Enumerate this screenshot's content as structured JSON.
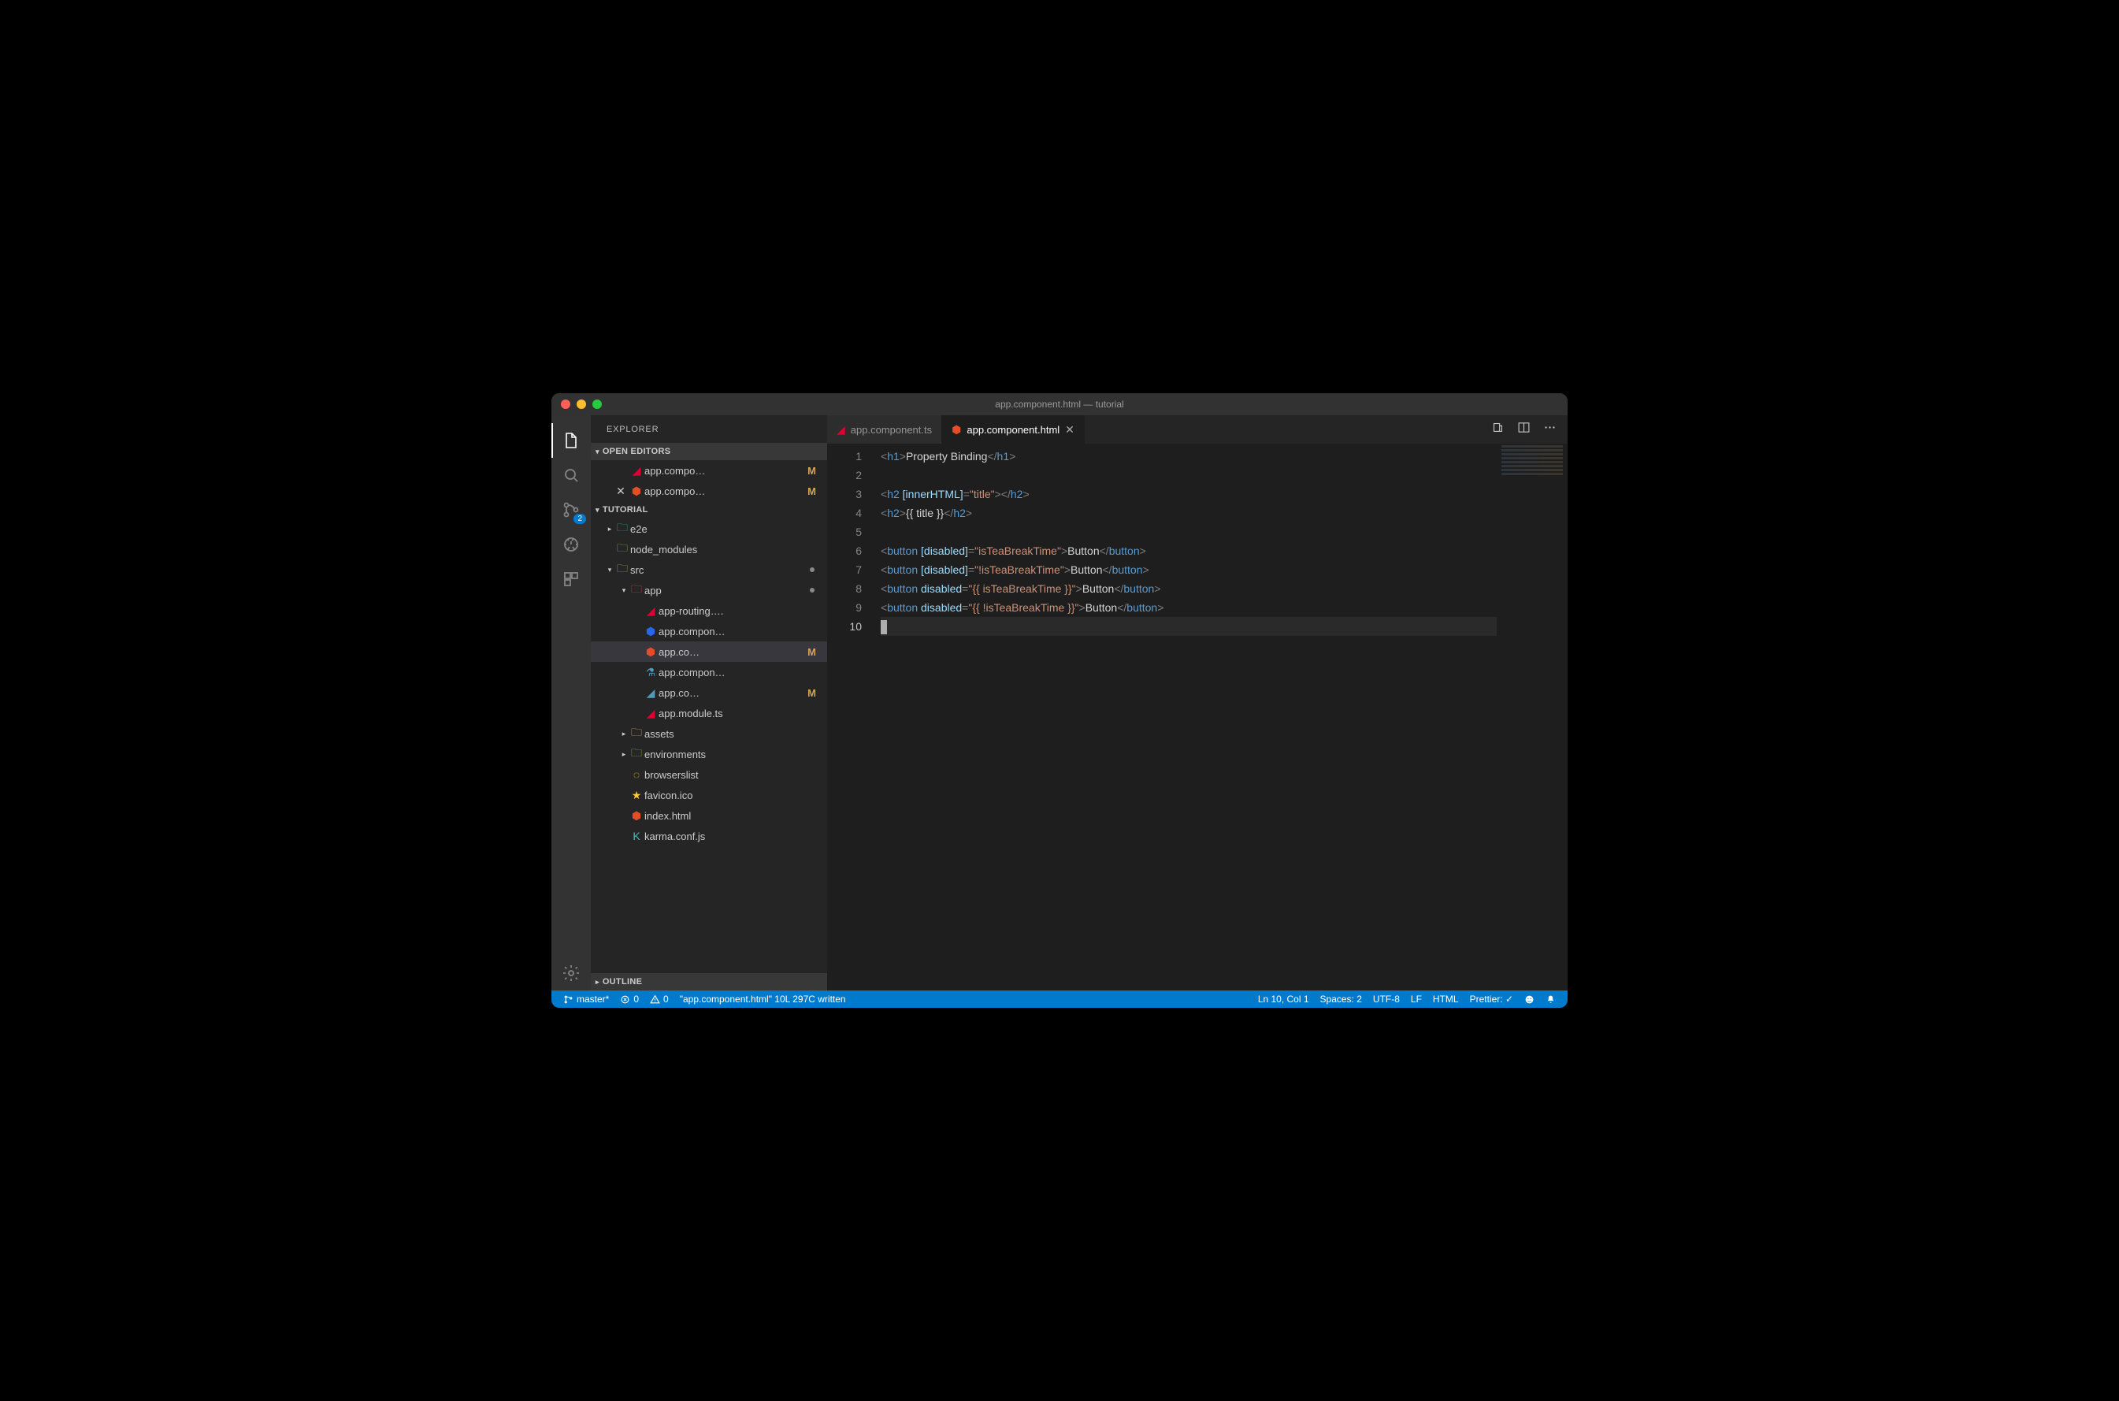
{
  "titlebar": {
    "title": "app.component.html — tutorial"
  },
  "sidebar": {
    "title": "EXPLORER",
    "open_editors_label": "OPEN EDITORS",
    "outline_label": "OUTLINE",
    "project_label": "TUTORIAL",
    "open_editors": [
      {
        "label": "app.compo…",
        "marker": "M",
        "icon": "angular"
      },
      {
        "label": "app.compo…",
        "marker": "M",
        "icon": "html",
        "close": true
      }
    ],
    "tree": [
      {
        "depth": 0,
        "tw": "▸",
        "icon": "folder-teal",
        "label": "e2e"
      },
      {
        "depth": 0,
        "tw": "",
        "icon": "folder-green",
        "label": "node_modules"
      },
      {
        "depth": 0,
        "tw": "▾",
        "icon": "folder-green",
        "label": "src",
        "mod": true
      },
      {
        "depth": 1,
        "tw": "▾",
        "icon": "folder-red",
        "label": "app",
        "mod": true
      },
      {
        "depth": 2,
        "tw": "",
        "icon": "angular",
        "label": "app-routing…."
      },
      {
        "depth": 2,
        "tw": "",
        "icon": "css",
        "label": "app.compon…"
      },
      {
        "depth": 2,
        "tw": "",
        "icon": "html",
        "label": "app.co…",
        "marker": "M",
        "sel": true
      },
      {
        "depth": 2,
        "tw": "",
        "icon": "flask",
        "label": "app.compon…"
      },
      {
        "depth": 2,
        "tw": "",
        "icon": "angular-sh",
        "label": "app.co…",
        "marker": "M"
      },
      {
        "depth": 2,
        "tw": "",
        "icon": "angular",
        "label": "app.module.ts"
      },
      {
        "depth": 1,
        "tw": "▸",
        "icon": "folder",
        "label": "assets"
      },
      {
        "depth": 1,
        "tw": "▸",
        "icon": "folder-green",
        "label": "environments"
      },
      {
        "depth": 1,
        "tw": "",
        "icon": "browserslist",
        "label": "browserslist"
      },
      {
        "depth": 1,
        "tw": "",
        "icon": "star",
        "label": "favicon.ico"
      },
      {
        "depth": 1,
        "tw": "",
        "icon": "html",
        "label": "index.html"
      },
      {
        "depth": 1,
        "tw": "",
        "icon": "karma",
        "label": "karma.conf.js"
      }
    ]
  },
  "activity_badge": "2",
  "tabs": [
    {
      "label": "app.component.ts",
      "icon": "angular",
      "active": false
    },
    {
      "label": "app.component.html",
      "icon": "html",
      "active": true,
      "close": true
    }
  ],
  "editor": {
    "cursor_line": 10,
    "lines": [
      {
        "n": 1,
        "tokens": [
          [
            "p",
            "<"
          ],
          [
            "tag",
            "h1"
          ],
          [
            "p",
            ">"
          ],
          [
            "txt",
            "Property Binding"
          ],
          [
            "p",
            "</"
          ],
          [
            "tag",
            "h1"
          ],
          [
            "p",
            ">"
          ]
        ]
      },
      {
        "n": 2,
        "tokens": []
      },
      {
        "n": 3,
        "tokens": [
          [
            "p",
            "<"
          ],
          [
            "tag",
            "h2"
          ],
          [
            "txt",
            " "
          ],
          [
            "attr",
            "[innerHTML]"
          ],
          [
            "p",
            "="
          ],
          [
            "str",
            "\"title\""
          ],
          [
            "p",
            "></"
          ],
          [
            "tag",
            "h2"
          ],
          [
            "p",
            ">"
          ]
        ]
      },
      {
        "n": 4,
        "tokens": [
          [
            "p",
            "<"
          ],
          [
            "tag",
            "h2"
          ],
          [
            "p",
            ">"
          ],
          [
            "txt",
            "{{ title }}"
          ],
          [
            "p",
            "</"
          ],
          [
            "tag",
            "h2"
          ],
          [
            "p",
            ">"
          ]
        ]
      },
      {
        "n": 5,
        "tokens": []
      },
      {
        "n": 6,
        "tokens": [
          [
            "p",
            "<"
          ],
          [
            "tag",
            "button"
          ],
          [
            "txt",
            " "
          ],
          [
            "attr",
            "[disabled]"
          ],
          [
            "p",
            "="
          ],
          [
            "str",
            "\"isTeaBreakTime\""
          ],
          [
            "p",
            ">"
          ],
          [
            "txt",
            "Button"
          ],
          [
            "p",
            "</"
          ],
          [
            "tag",
            "button"
          ],
          [
            "p",
            ">"
          ]
        ]
      },
      {
        "n": 7,
        "tokens": [
          [
            "p",
            "<"
          ],
          [
            "tag",
            "button"
          ],
          [
            "txt",
            " "
          ],
          [
            "attr",
            "[disabled]"
          ],
          [
            "p",
            "="
          ],
          [
            "str",
            "\"!isTeaBreakTime\""
          ],
          [
            "p",
            ">"
          ],
          [
            "txt",
            "Button"
          ],
          [
            "p",
            "</"
          ],
          [
            "tag",
            "button"
          ],
          [
            "p",
            ">"
          ]
        ]
      },
      {
        "n": 8,
        "tokens": [
          [
            "p",
            "<"
          ],
          [
            "tag",
            "button"
          ],
          [
            "txt",
            " "
          ],
          [
            "attr",
            "disabled"
          ],
          [
            "p",
            "="
          ],
          [
            "str",
            "\"{{ isTeaBreakTime }}\""
          ],
          [
            "p",
            ">"
          ],
          [
            "txt",
            "Button"
          ],
          [
            "p",
            "</"
          ],
          [
            "tag",
            "button"
          ],
          [
            "p",
            ">"
          ]
        ]
      },
      {
        "n": 9,
        "tokens": [
          [
            "p",
            "<"
          ],
          [
            "tag",
            "button"
          ],
          [
            "txt",
            " "
          ],
          [
            "attr",
            "disabled"
          ],
          [
            "p",
            "="
          ],
          [
            "str",
            "\"{{ !isTeaBreakTime }}\""
          ],
          [
            "p",
            ">"
          ],
          [
            "txt",
            "Button"
          ],
          [
            "p",
            "</"
          ],
          [
            "tag",
            "button"
          ],
          [
            "p",
            ">"
          ]
        ]
      },
      {
        "n": 10,
        "tokens": [],
        "cursor": true
      }
    ]
  },
  "status": {
    "branch": "master*",
    "errors": "0",
    "warnings": "0",
    "message": "\"app.component.html\" 10L 297C written",
    "position": "Ln 10, Col 1",
    "spaces": "Spaces: 2",
    "encoding": "UTF-8",
    "eol": "LF",
    "lang": "HTML",
    "prettier": "Prettier: ✓"
  }
}
